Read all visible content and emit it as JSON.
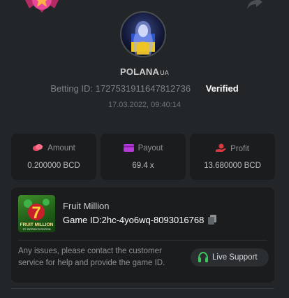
{
  "profile": {
    "username": "POLANA",
    "username_suffix": "UA",
    "betting_id_label": "Betting ID:",
    "betting_id": "1727531911647812736",
    "verified_label": "Verified",
    "datetime": "17.03.2022, 09:40:14"
  },
  "stats": [
    {
      "label": "Amount",
      "value": "0.200000 BCD",
      "icon": "coins-icon",
      "color": "#e44b69"
    },
    {
      "label": "Payout",
      "value": "69.4 x",
      "icon": "wallet-icon",
      "color": "#b63ad8"
    },
    {
      "label": "Profit",
      "value": "13.680000 BCD",
      "icon": "hand-coin-icon",
      "color": "#e0383f"
    }
  ],
  "game": {
    "name": "Fruit Million",
    "id_label": "Game ID:",
    "id_value": "2hc-4yo6wq-8093016768",
    "thumbnail_title": "FRUIT MILLION",
    "thumbnail_subtitle": "ST. PATRICK'S EDITION",
    "thumbnail_digit": "7",
    "note": "Any issues, please contact the customer service for help and provide the game ID.",
    "support_label": "Live Support"
  },
  "colors": {
    "background": "#232628",
    "card": "#1a1c1e",
    "support_icon": "#3cc85a"
  }
}
